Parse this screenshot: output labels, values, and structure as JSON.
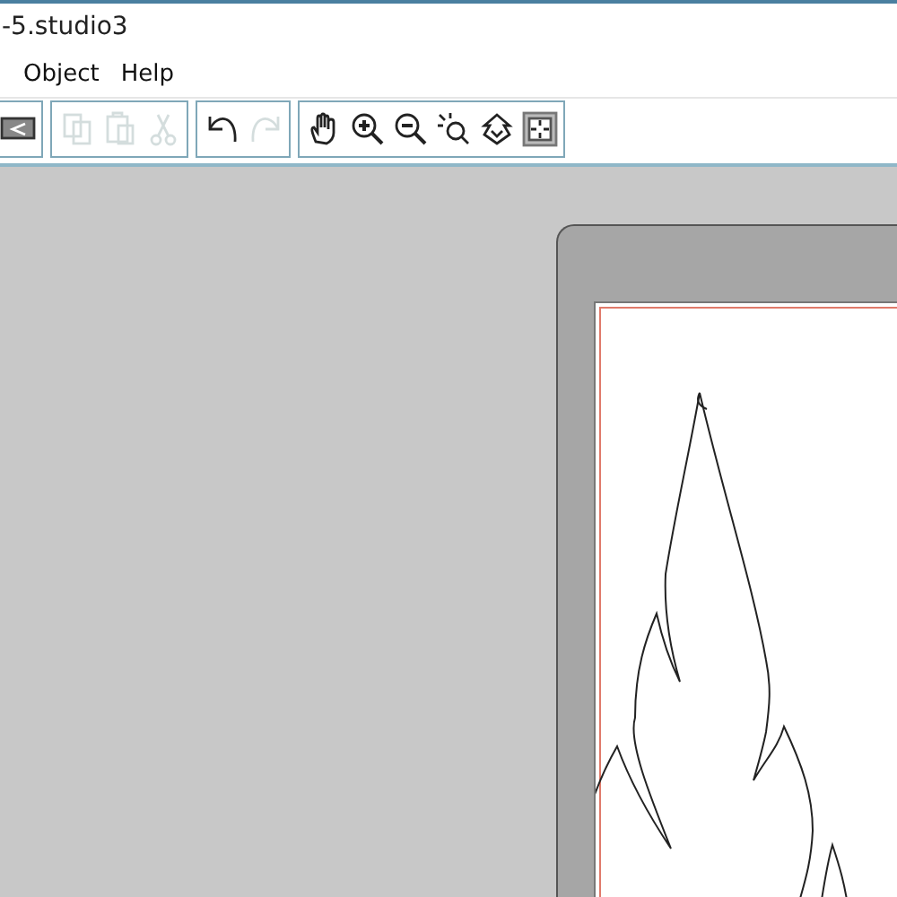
{
  "window": {
    "title": "-5.studio3"
  },
  "menu": [
    {
      "label": "Object"
    },
    {
      "label": "Help"
    }
  ],
  "toolbar": [
    [
      {
        "kind": "send",
        "disabled": false
      }
    ],
    [
      {
        "kind": "copy",
        "disabled": true
      },
      {
        "kind": "paste",
        "disabled": true
      },
      {
        "kind": "cut",
        "disabled": true
      }
    ],
    [
      {
        "kind": "undo",
        "disabled": false
      },
      {
        "kind": "redo",
        "disabled": true
      }
    ],
    [
      {
        "kind": "hand",
        "disabled": false
      },
      {
        "kind": "zoomin",
        "disabled": false
      },
      {
        "kind": "zoomout",
        "disabled": false
      },
      {
        "kind": "zoomselect",
        "disabled": false
      },
      {
        "kind": "fitdown",
        "disabled": false
      },
      {
        "kind": "fitpage",
        "disabled": false
      }
    ]
  ]
}
